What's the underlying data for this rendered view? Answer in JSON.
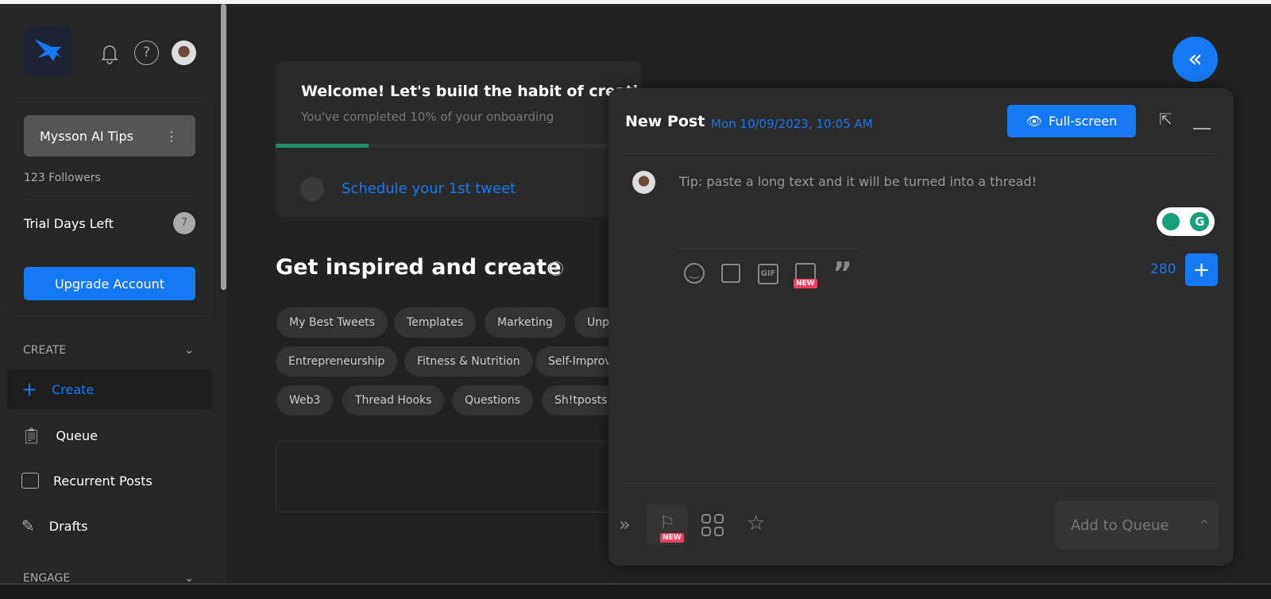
{
  "sidebar": {
    "account_name": "Mysson AI Tips",
    "followers": "123 Followers",
    "trial_label": "Trial Days Left",
    "trial_days": "7",
    "upgrade": "Upgrade Account",
    "create_section": "CREATE",
    "engage_section": "ENGAGE",
    "items": [
      {
        "label": "Create",
        "icon": "plus-icon",
        "active": true
      },
      {
        "label": "Queue",
        "icon": "clipboard-check-icon"
      },
      {
        "label": "Recurrent Posts",
        "icon": "calendar-icon"
      },
      {
        "label": "Drafts",
        "icon": "edit-icon"
      }
    ]
  },
  "onboarding": {
    "title": "Welcome! Let's build the habit of creati",
    "subtitle": "You've completed 10% of your onboarding",
    "progress_percent": 10,
    "task": "Schedule your 1st tweet"
  },
  "inspire": {
    "title": "Get inspired and create",
    "chips": [
      [
        "My Best Tweets",
        "Templates",
        "Marketing",
        "Unp"
      ],
      [
        "Entrepreneurship",
        "Fitness & Nutrition",
        "Self-Improv"
      ],
      [
        "Web3",
        "Thread Hooks",
        "Questions",
        "Sh!tposts"
      ]
    ]
  },
  "composer": {
    "title": "New Post",
    "datetime": "Mon 10/09/2023, 10:05 AM",
    "fullscreen": "Full-screen",
    "placeholder": "Tip: paste a long text and it will be turned into a thread!",
    "char_count": "280",
    "new_badge": "NEW",
    "gif": "GIF",
    "add_to_queue": "Add to Queue"
  },
  "colors": {
    "accent": "#1479f2",
    "progress": "#1f8f67",
    "badge": "#ee3f62"
  }
}
